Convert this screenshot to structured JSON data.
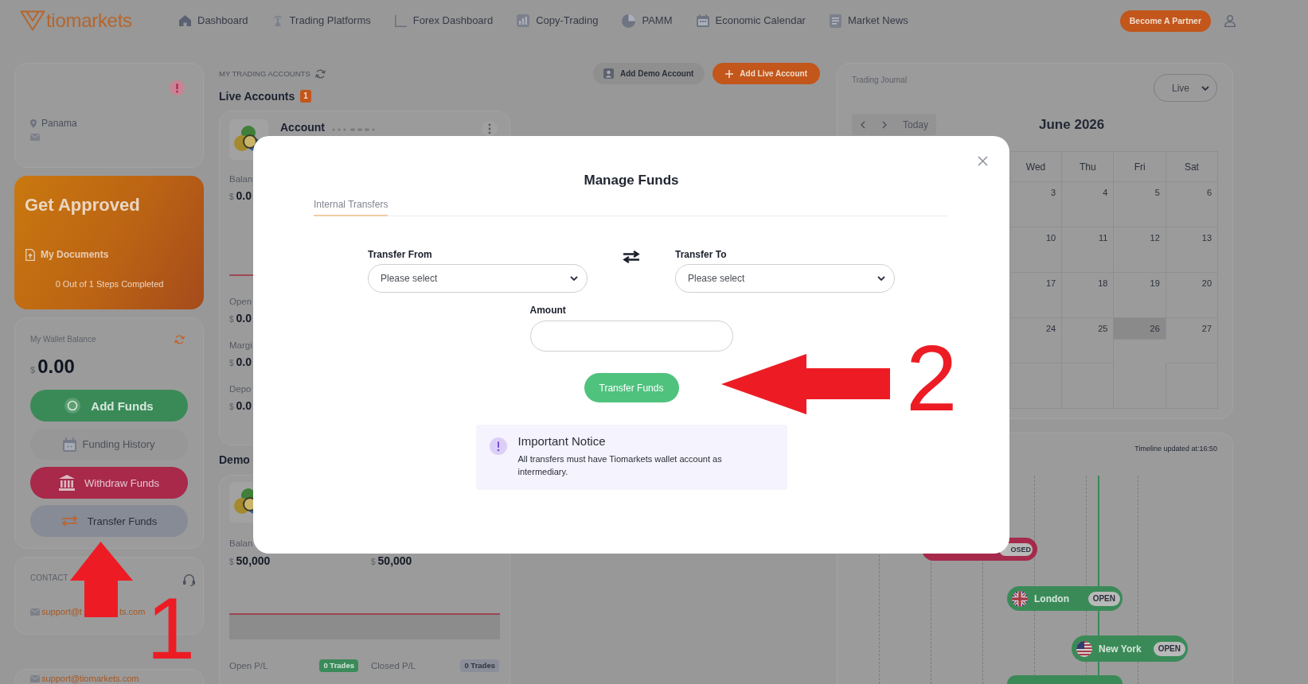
{
  "top_nav": {
    "logo": "tiomarkets",
    "items": [
      "Dashboard",
      "Trading Platforms",
      "Forex Dashboard",
      "Copy-Trading",
      "PAMM",
      "Economic Calendar",
      "Market News"
    ],
    "partner_button": "Become A Partner"
  },
  "profile_card": {
    "location": "Panama"
  },
  "approval_card": {
    "title": "Get Approved",
    "documents_link": "My Documents",
    "progress": "0 Out of 1 Steps Completed"
  },
  "wallet_card": {
    "label": "My Wallet Balance",
    "currency": "$",
    "balance": "0.00",
    "actions": [
      {
        "label": "Add Funds",
        "kind": "add"
      },
      {
        "label": "Funding History",
        "kind": "history"
      },
      {
        "label": "Withdraw Funds",
        "kind": "withdraw"
      },
      {
        "label": "Transfer Funds",
        "kind": "transfer"
      }
    ]
  },
  "contact_card": {
    "heading": "CONTACT",
    "email_visible_parts": [
      "support@t",
      "ts.com"
    ]
  },
  "support_card": {
    "email": "support@tiomarkets.com"
  },
  "accounts": {
    "heading": "MY TRADING ACCOUNTS",
    "buttons": [
      {
        "label": "Add Demo Account",
        "kind": "demo"
      },
      {
        "label": "Add Live Account",
        "kind": "live"
      }
    ],
    "live": {
      "title": "Live Accounts",
      "count": "1",
      "account_name": "Account",
      "fields": [
        {
          "label": "Balan",
          "currency": "$",
          "value": "0.0"
        },
        {
          "label": "Open",
          "currency": "$",
          "value": "0.0"
        },
        {
          "label": "Margi",
          "currency": "$",
          "value": "0.0"
        },
        {
          "label": "Depo",
          "currency": "$",
          "value": "0.0"
        }
      ]
    },
    "demo": {
      "title": "Demo",
      "fields": [
        {
          "label": "Balan",
          "currency": "$",
          "value": "50,000"
        },
        {
          "currency": "$",
          "value": "50,000"
        }
      ],
      "pl": [
        {
          "label": "Open P/L",
          "trades": "0 Trades",
          "kind": "open"
        },
        {
          "label": "Closed P/L",
          "trades": "0 Trades",
          "kind": "closed"
        }
      ]
    }
  },
  "trading_journal": {
    "title": "Trading Journal",
    "account_type": "Live",
    "today_button": "Today",
    "month": "June 2026",
    "weekdays": [
      "Wed",
      "Thu",
      "Fri",
      "Sat"
    ],
    "weeks": [
      [
        {
          "day": "3",
          "today": false
        },
        {
          "day": "4",
          "today": false
        },
        {
          "day": "5",
          "today": false
        },
        {
          "day": "6",
          "today": false
        }
      ],
      [
        {
          "day": "10",
          "today": false
        },
        {
          "day": "11",
          "today": false
        },
        {
          "day": "12",
          "today": false
        },
        {
          "day": "13",
          "today": false
        }
      ],
      [
        {
          "day": "17",
          "today": false
        },
        {
          "day": "18",
          "today": false
        },
        {
          "day": "19",
          "today": false
        },
        {
          "day": "20",
          "today": false
        }
      ],
      [
        {
          "day": "24",
          "today": false
        },
        {
          "day": "25",
          "today": false
        },
        {
          "day": "26",
          "today": true
        },
        {
          "day": "27",
          "today": false
        }
      ],
      [
        {
          "today": false
        },
        {
          "today": false
        },
        {
          "today": false
        },
        {
          "today": false
        }
      ]
    ]
  },
  "timeline": {
    "updated": "Timeline updated at:16:50",
    "sessions": [
      {
        "status": "OSED",
        "kind": "closed"
      },
      {
        "name": "London",
        "status": "OPEN",
        "kind": "open"
      },
      {
        "name": "New York",
        "status": "OPEN",
        "kind": "open"
      },
      {
        "kind": "open"
      }
    ]
  },
  "modal": {
    "title": "Manage Funds",
    "tabs": [
      {
        "label": "Internal Transfers",
        "selected": true
      }
    ],
    "transfer_from": {
      "label": "Transfer From",
      "placeholder": "Please select"
    },
    "transfer_to": {
      "label": "Transfer To",
      "placeholder": "Please select"
    },
    "amount": {
      "label": "Amount"
    },
    "submit_button": "Transfer Funds",
    "notice": {
      "title": "Important Notice",
      "text": "All transfers must have Tiomarkets wallet account as intermediary."
    }
  },
  "annotations": [
    {
      "label": "1",
      "kind": "up-arrow"
    },
    {
      "label": "2",
      "kind": "left-arrow"
    }
  ]
}
